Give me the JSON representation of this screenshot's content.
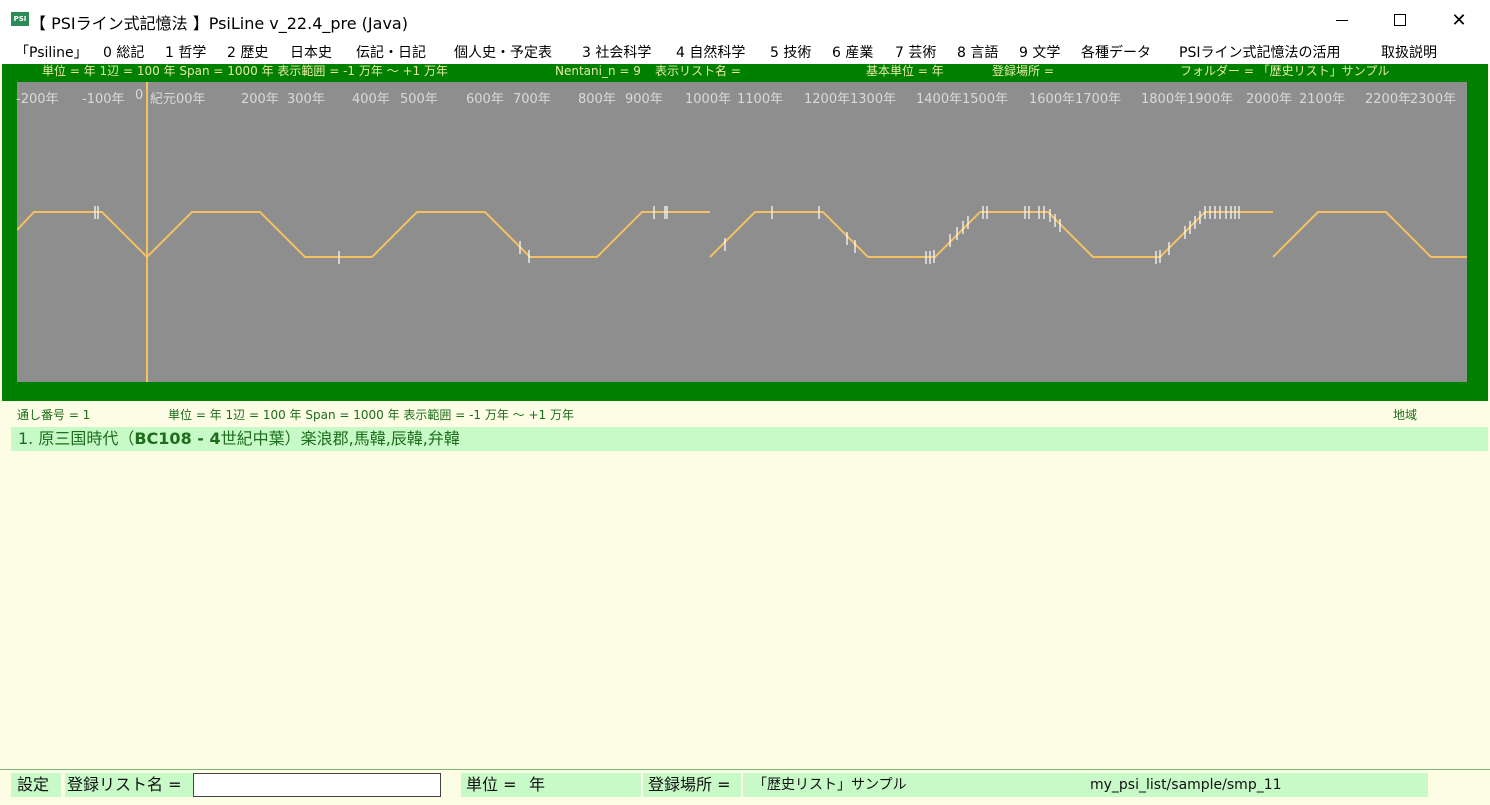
{
  "window": {
    "icon_text": "PSI",
    "title": "【 PSIライン式記憶法 】PsiLine v_22.4_pre (Java)",
    "minimize": "minimize",
    "maximize": "maximize",
    "close": "✕"
  },
  "menu": [
    "「Psiline」",
    "0 総記",
    "1 哲学",
    "2 歴史",
    "日本史",
    "伝記・日記",
    "個人史・予定表",
    "3 社会科学",
    "4 自然科学",
    "5 技術",
    "6 産業",
    "7 芸術",
    "8 言語",
    "9 文学",
    "各種データ",
    "PSIライン式記憶法の活用",
    "取扱説明"
  ],
  "info_bar": {
    "unit_info": "単位 = 年  1辺 = 100 年  Span = 1000 年  表示範囲 = -1 万年 〜 +1 万年",
    "nentani": "Nentani_n = 9",
    "display_list": "表示リスト名 =",
    "base_unit": "基本単位 = 年",
    "registered_place": "登録場所 =",
    "folder": "フォルダー = 「歴史リスト」サンプル"
  },
  "timeline": {
    "year_labels": [
      "-200年",
      "-100年",
      "0",
      "紀元00年",
      "200年",
      "300年",
      "400年",
      "500年",
      "600年",
      "700年",
      "800年",
      "900年",
      "1000年",
      "1100年",
      "1200年",
      "1300年",
      "1400年",
      "1500年",
      "1600年",
      "1700年",
      "1800年",
      "1900年",
      "2000年",
      "2100年",
      "2200年",
      "2300年"
    ],
    "line_color": "#f5c060",
    "plot_bg": "#8e8e8e",
    "frame_color": "#008000"
  },
  "list_header": {
    "serial": "通し番号 = 1",
    "unit_info": "単位 = 年  1辺 = 100 年  Span = 1000 年  表示範囲 = -1 万年 〜 +1 万年",
    "region": "地域"
  },
  "list_items": [
    {
      "prefix": "1. 原三国時代（",
      "range": "BC108 - 4",
      "suffix": "世紀中葉）楽浪郡,馬韓,辰韓,弁韓"
    }
  ],
  "status_bar": {
    "settings": "設定",
    "list_name_label": "登録リスト名 =",
    "list_name_value": "",
    "unit_label": "単位 =",
    "unit_value": "年",
    "place_label": "登録場所 =",
    "place_value": "「歴史リスト」サンプル",
    "path": "my_psi_list/sample/smp_11"
  }
}
